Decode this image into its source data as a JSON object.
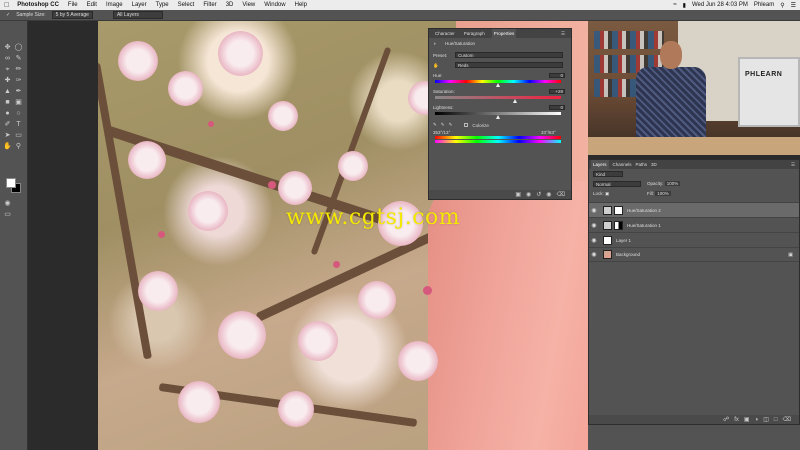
{
  "menubar": {
    "apple": "",
    "app": "Photoshop CC",
    "items": [
      "File",
      "Edit",
      "Image",
      "Layer",
      "Type",
      "Select",
      "Filter",
      "3D",
      "View",
      "Window",
      "Help"
    ],
    "clock": "Wed Jun 28  4:03 PM",
    "user": "Phleam"
  },
  "options": {
    "sample_label": "Sample Size:",
    "sample_value": "5 by 5 Average",
    "layers_value": "All Layers"
  },
  "properties": {
    "tabs": [
      "Character",
      "Paragraph",
      "Properties"
    ],
    "title": "Hue/Saturation",
    "preset_label": "Preset:",
    "preset_value": "Custom",
    "channel_value": "Reds",
    "hue_label": "Hue:",
    "hue_value": "0",
    "saturation_label": "Saturation:",
    "saturation_value": "+28",
    "lightness_label": "Lightness:",
    "lightness_value": "0",
    "colorize_label": "Colorize",
    "range_left": "353°/13°",
    "range_right": "33°/63°",
    "hue_level": 0.5,
    "saturation_level": 0.64,
    "lightness_level": 0.5
  },
  "watermark": "www.cgtsj.com",
  "video": {
    "monitor_logo": "PHLEARN"
  },
  "layers": {
    "tabs": [
      "Layers",
      "Channels",
      "Paths",
      "3D"
    ],
    "filter_value": "Kind",
    "blend_value": "Normal",
    "opacity_label": "Opacity:",
    "opacity_value": "100%",
    "lock_label": "Lock:",
    "fill_label": "Fill:",
    "fill_value": "100%",
    "items": [
      {
        "name": "Hue/Saturation 2"
      },
      {
        "name": "Hue/Saturation 1"
      },
      {
        "name": "Layer 1"
      },
      {
        "name": "Background"
      }
    ]
  },
  "colors": {
    "panel_bg": "#535353",
    "watermark": "#f5e800",
    "menubar_bg": "#ececec"
  }
}
